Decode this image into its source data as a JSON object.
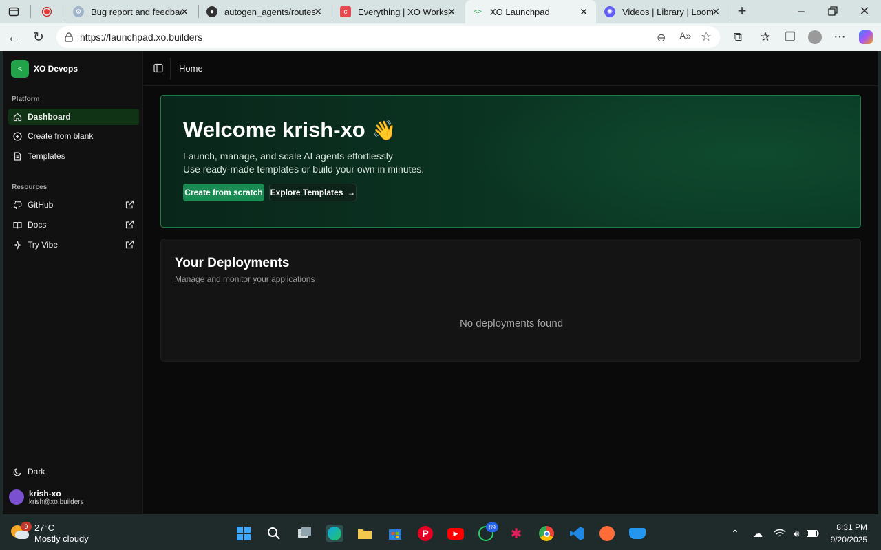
{
  "browser": {
    "tabs": [
      {
        "title": "Bug report and feedback",
        "active": false
      },
      {
        "title": "autogen_agents/routes/c",
        "active": false
      },
      {
        "title": "Everything | XO Workspace",
        "active": false
      },
      {
        "title": "XO Launchpad",
        "active": true
      },
      {
        "title": "Videos | Library | Loom",
        "active": false
      }
    ],
    "url": "https://launchpad.xo.builders"
  },
  "sidebar": {
    "org_name": "XO Devops",
    "sections": {
      "platform": "Platform",
      "resources": "Resources"
    },
    "platform_items": [
      "Dashboard",
      "Create from blank",
      "Templates"
    ],
    "resource_items": [
      "GitHub",
      "Docs",
      "Try Vibe"
    ],
    "theme_label": "Dark",
    "user": {
      "name": "krish-xo",
      "email": "krish@xo.builders"
    }
  },
  "header": {
    "breadcrumb": "Home"
  },
  "hero": {
    "title": "Welcome krish-xo",
    "emoji": "👋",
    "line1": "Launch, manage, and scale AI agents effortlessly",
    "line2": "Use ready-made templates or build your own in minutes.",
    "primary_btn": "Create from scratch",
    "secondary_btn": "Explore Templates"
  },
  "deployments": {
    "title": "Your Deployments",
    "subtitle": "Manage and monitor your applications",
    "empty": "No deployments found"
  },
  "taskbar": {
    "temp": "27°C",
    "weather": "Mostly cloudy",
    "weather_badge": "9",
    "whatsapp_badge": "89",
    "time": "8:31 PM",
    "date": "9/20/2025"
  },
  "colors": {
    "accent": "#22a34a",
    "hero_border": "#1f7a43",
    "primary_button": "#1c8a53"
  }
}
